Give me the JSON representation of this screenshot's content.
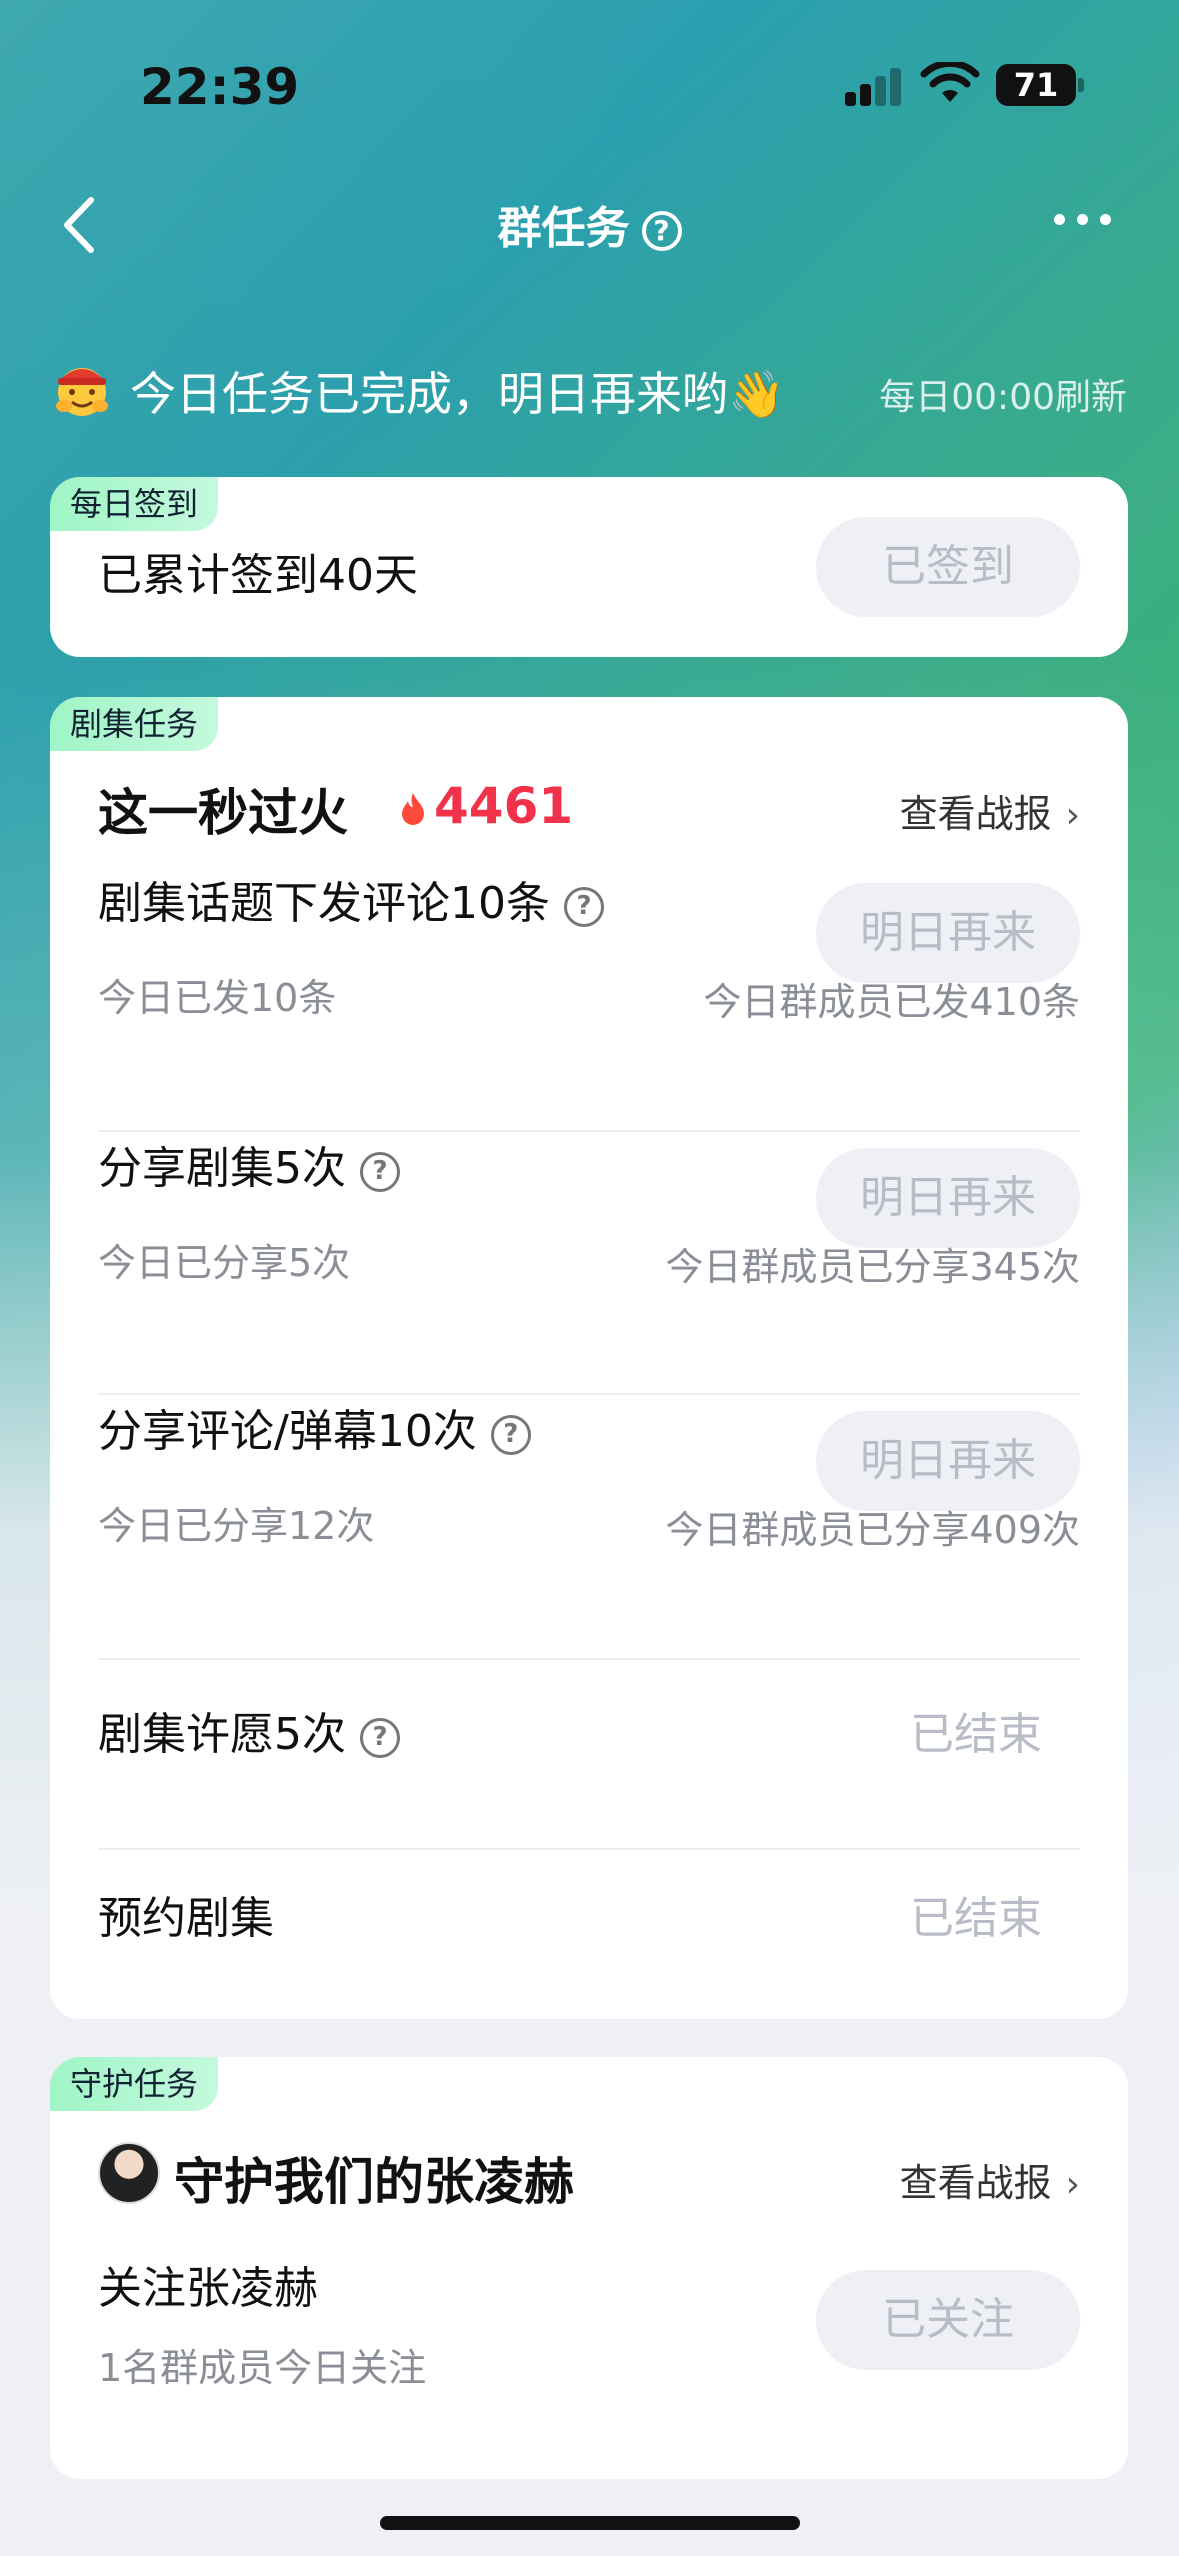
{
  "status": {
    "time": "22:39",
    "battery": "71"
  },
  "nav": {
    "title": "群任务",
    "help": "?"
  },
  "banner": {
    "text": "今日任务已完成，明日再来哟👋",
    "refresh": "每日00:00刷新"
  },
  "checkin": {
    "tag": "每日签到",
    "title": "已累计签到40天",
    "button": "已签到"
  },
  "drama": {
    "tag": "剧集任务",
    "show_name": "这一秒过火",
    "heat": "4461",
    "report": "查看战报",
    "tasks": [
      {
        "title": "剧集话题下发评论10条",
        "sub": "今日已发10条",
        "group": "今日群成员已发410条",
        "button": "明日再来"
      },
      {
        "title": "分享剧集5次",
        "sub": "今日已分享5次",
        "group": "今日群成员已分享345次",
        "button": "明日再来"
      },
      {
        "title": "分享评论/弹幕10次",
        "sub": "今日已分享12次",
        "group": "今日群成员已分享409次",
        "button": "明日再来"
      },
      {
        "title": "剧集许愿5次",
        "status": "已结束"
      },
      {
        "title": "预约剧集",
        "status": "已结束"
      }
    ]
  },
  "guard": {
    "tag": "守护任务",
    "name": "守护我们的张凌赫",
    "report": "查看战报",
    "task_title": "关注张凌赫",
    "task_sub": "1名群成员今日关注",
    "button": "已关注"
  }
}
